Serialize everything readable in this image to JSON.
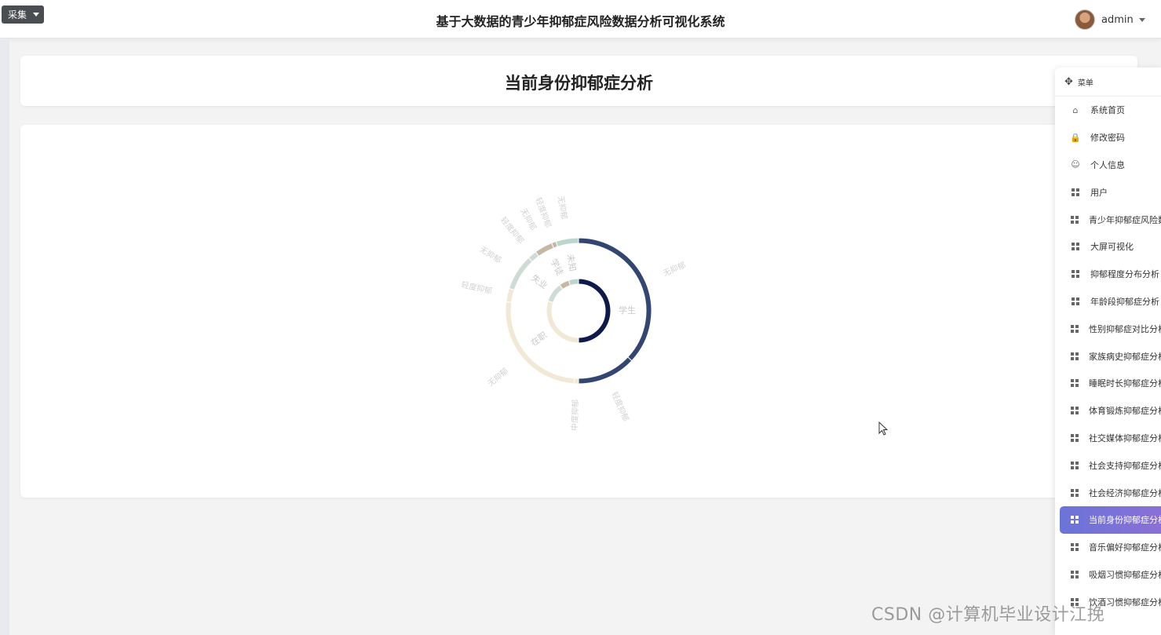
{
  "topbar": {
    "collect_label": "采集",
    "app_title": "基于大数据的青少年抑郁症风险数据分析可视化系统",
    "username": "admin"
  },
  "page": {
    "title": "当前身份抑郁症分析"
  },
  "menu": {
    "title": "菜单",
    "items": [
      {
        "label": "系统首页",
        "icon": "home-icon"
      },
      {
        "label": "修改密码",
        "icon": "lock-icon"
      },
      {
        "label": "个人信息",
        "icon": "user-icon"
      },
      {
        "label": "用户",
        "icon": "grid-icon"
      },
      {
        "label": "青少年抑郁症风险数",
        "icon": "grid-icon"
      },
      {
        "label": "大屏可视化",
        "icon": "grid-icon"
      },
      {
        "label": "抑郁程度分布分析",
        "icon": "grid-icon"
      },
      {
        "label": "年龄段抑郁症分析",
        "icon": "grid-icon"
      },
      {
        "label": "性别抑郁症对比分析",
        "icon": "grid-icon"
      },
      {
        "label": "家族病史抑郁症分析",
        "icon": "grid-icon"
      },
      {
        "label": "睡眠时长抑郁症分析",
        "icon": "grid-icon"
      },
      {
        "label": "体育锻炼抑郁症分析",
        "icon": "grid-icon"
      },
      {
        "label": "社交媒体抑郁症分析",
        "icon": "grid-icon"
      },
      {
        "label": "社会支持抑郁症分析",
        "icon": "grid-icon"
      },
      {
        "label": "社会经济抑郁症分析",
        "icon": "grid-icon"
      },
      {
        "label": "当前身份抑郁症分析",
        "icon": "grid-icon",
        "active": true
      },
      {
        "label": "音乐偏好抑郁症分析",
        "icon": "grid-icon"
      },
      {
        "label": "吸烟习惯抑郁症分析",
        "icon": "grid-icon"
      },
      {
        "label": "饮酒习惯抑郁症分析",
        "icon": "grid-icon"
      }
    ]
  },
  "watermark": "CSDN @计算机毕业设计江挽",
  "chart_data": {
    "type": "pie",
    "subtype": "sunburst",
    "colors": {
      "学生": "#0d1a4a",
      "在职": "#f1e9d6",
      "失业": "#cfdcd5",
      "学徒": "#c6b8a4",
      "未知": "#bcd6cc",
      "outer_blue": "#324671"
    },
    "inner": [
      {
        "name": "学生",
        "value": 50
      },
      {
        "name": "在职",
        "value": 30
      },
      {
        "name": "失业",
        "value": 10
      },
      {
        "name": "学徒",
        "value": 5
      },
      {
        "name": "未知",
        "value": 5
      }
    ],
    "outer": [
      {
        "parent": "学生",
        "name": "无抑郁",
        "value": 37
      },
      {
        "parent": "学生",
        "name": "轻度抑郁",
        "value": 13
      },
      {
        "parent": "在职",
        "name": "中度抑郁",
        "value": 1
      },
      {
        "parent": "在职",
        "name": "无抑郁",
        "value": 26
      },
      {
        "parent": "在职",
        "name": "轻度抑郁",
        "value": 3
      },
      {
        "parent": "失业",
        "name": "无抑郁",
        "value": 8
      },
      {
        "parent": "失业",
        "name": "轻度抑郁",
        "value": 2
      },
      {
        "parent": "学徒",
        "name": "无抑郁",
        "value": 4
      },
      {
        "parent": "学徒",
        "name": "轻度抑郁",
        "value": 1
      },
      {
        "parent": "未知",
        "name": "无抑郁",
        "value": 5
      }
    ]
  }
}
